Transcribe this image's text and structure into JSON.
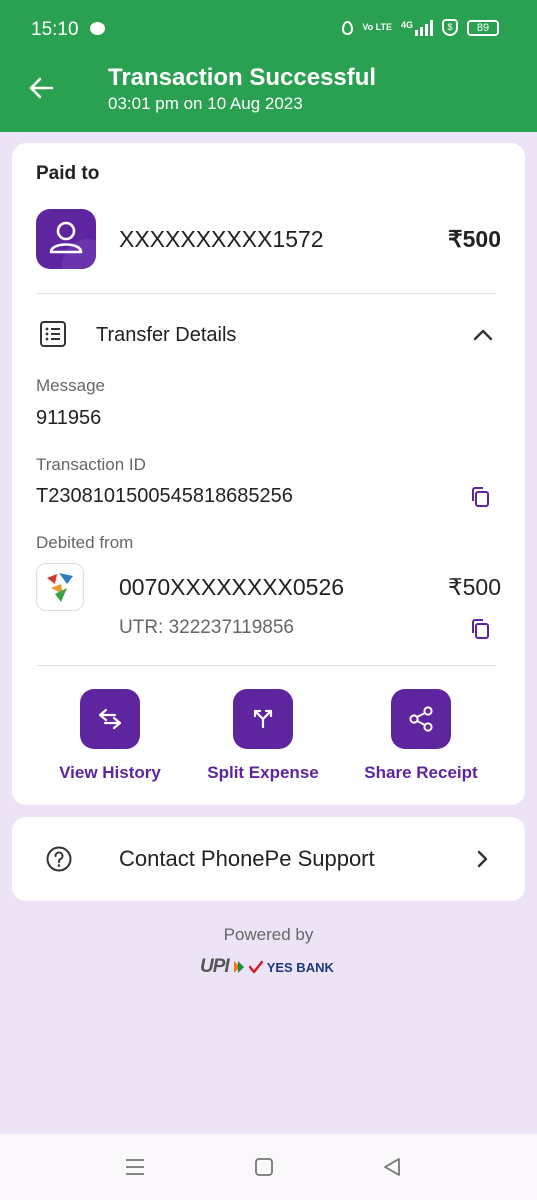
{
  "status_bar": {
    "time": "15:10",
    "volte": "Vo LTE",
    "network": "4G",
    "battery": "89"
  },
  "header": {
    "title": "Transaction Successful",
    "subtitle": "03:01 pm on 10 Aug 2023",
    "bg_color": "#2aa150"
  },
  "paid_to": {
    "heading": "Paid to",
    "payee": "XXXXXXXXXX1572",
    "amount": "₹500"
  },
  "transfer_details": {
    "heading": "Transfer Details",
    "message_label": "Message",
    "message_value": "911956",
    "txn_id_label": "Transaction ID",
    "txn_id_value": "T2308101500545818685256",
    "debited_label": "Debited from",
    "account": "0070XXXXXXXX0526",
    "amount": "₹500",
    "utr": "UTR: 322237119856"
  },
  "actions": [
    {
      "label": "View History",
      "icon": "history-arrows-icon"
    },
    {
      "label": "Split Expense",
      "icon": "split-icon"
    },
    {
      "label": "Share Receipt",
      "icon": "share-icon"
    }
  ],
  "support": {
    "label": "Contact PhonePe Support"
  },
  "footer": {
    "powered_by": "Powered by",
    "upi": "UPI",
    "bank": "YES BANK"
  },
  "accent_color": "#5f259f"
}
